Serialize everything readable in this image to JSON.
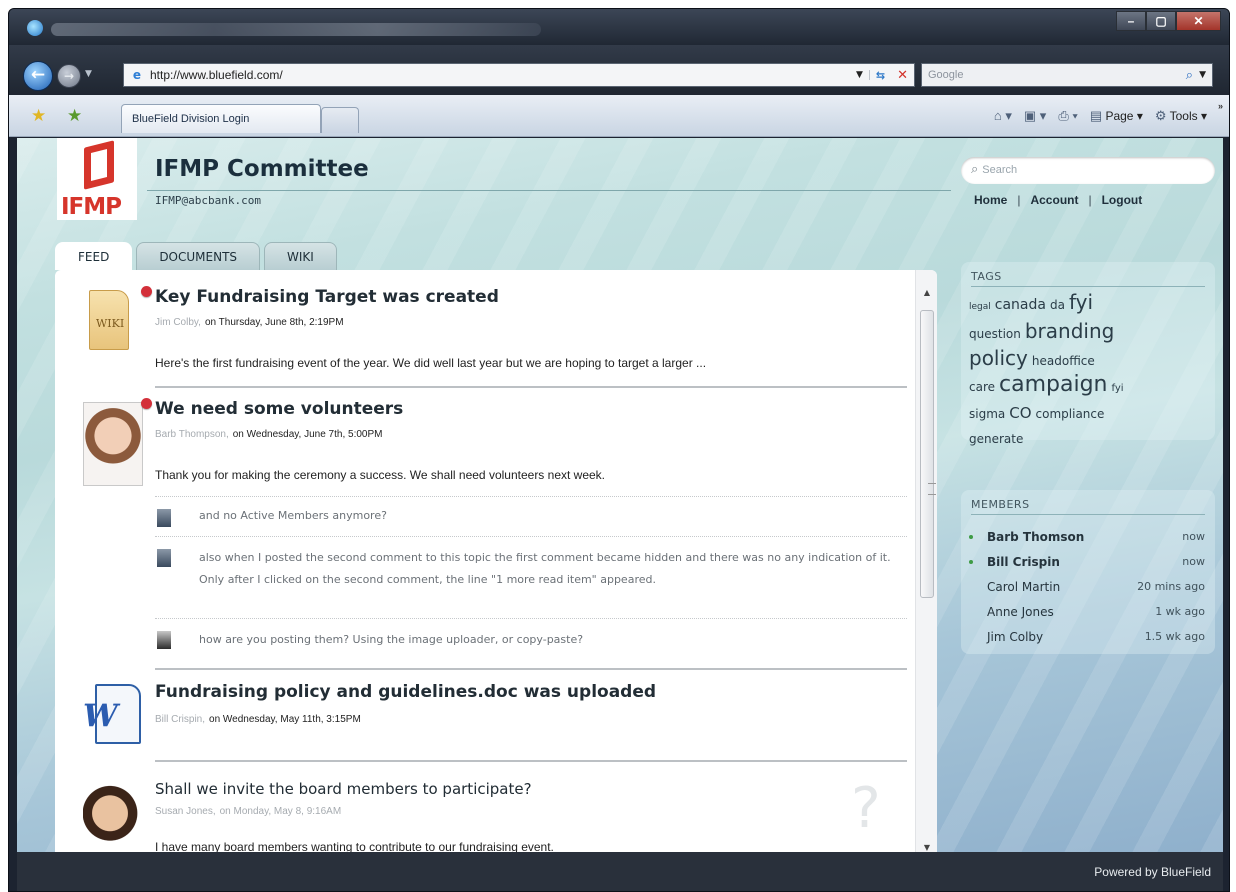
{
  "browser": {
    "address": "http://www.bluefield.com/",
    "search_placeholder": "Google",
    "tab_title": "BlueField Division Login",
    "commands": {
      "page": "Page",
      "tools": "Tools"
    }
  },
  "site": {
    "logo_text": "IFMP",
    "title": "IFMP Committee",
    "email": "IFMP@abcbank.com",
    "search_placeholder": "Search",
    "links": {
      "home": "Home",
      "account": "Account",
      "logout": "Logout"
    },
    "tabs": [
      "FEED",
      "DOCUMENTS",
      "WIKI"
    ]
  },
  "feed": {
    "posts": [
      {
        "title": "Key Fundraising Target was created",
        "author": "Jim Colby,",
        "date": "on Thursday, June 8th, 2:19PM",
        "body": "Here's the first fundraising event of the year. We did well last year but we are hoping to target a larger ...",
        "icon_label": "WIKI"
      },
      {
        "title": "We need some volunteers",
        "author": "Barb Thompson,",
        "date": "on Wednesday, June 7th, 5:00PM",
        "body": "Thank you for making the ceremony a success. We shall need volunteers next week."
      },
      {
        "title": "Fundraising policy and guidelines.doc was uploaded",
        "author": "Bill Crispin,",
        "date": "on Wednesday, May 11th, 3:15PM",
        "icon_label": "W"
      },
      {
        "title": "Shall we invite the board members to participate?",
        "author": "Susan Jones,",
        "date": "on Monday, May 8, 9:16AM",
        "body": "I have many board members wanting to contribute to our fundraising event."
      }
    ],
    "comments": [
      "and no Active Members anymore?",
      "also when I posted the second comment to this topic the first comment became hidden and there was no any indication of it. Only after I clicked on the second comment, the line \"1 more read item\" appeared.",
      "how are you posting them? Using the image uploader, or copy-paste?"
    ],
    "question_mark": "?"
  },
  "tags": {
    "title": "TAGS",
    "items": [
      "legal",
      "canada",
      "da",
      "fyi",
      "question",
      "branding",
      "policy",
      "headoffice",
      "care",
      "campaign",
      "fyi",
      "sigma",
      "CO",
      "compliance",
      "generate"
    ]
  },
  "members": {
    "title": "MEMBERS",
    "list": [
      {
        "name": "Barb Thomson",
        "time": "now"
      },
      {
        "name": "Bill Crispin",
        "time": "now"
      },
      {
        "name": "Carol Martin",
        "time": "20 mins ago"
      },
      {
        "name": "Anne Jones",
        "time": "1 wk ago"
      },
      {
        "name": "Jim Colby",
        "time": "1.5 wk ago"
      }
    ]
  },
  "footer": {
    "text": "Powered by BlueField"
  }
}
